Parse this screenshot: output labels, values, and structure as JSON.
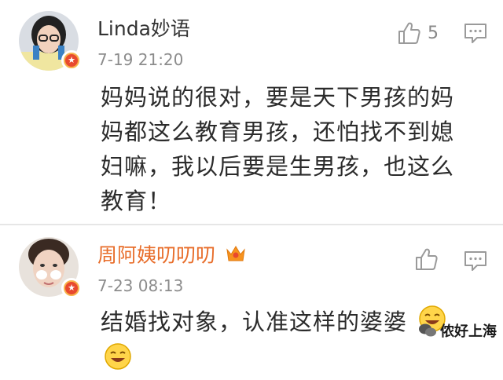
{
  "comments": [
    {
      "username": "Linda妙语",
      "timestamp": "7-19 21:20",
      "like_count": "5",
      "text": "妈妈说的很对，要是天下男孩的妈妈都这么教育男孩，还怕找不到媳妇嘛，我以后要是生男孩，也这么教育！",
      "username_color": "#333333"
    },
    {
      "username": "周阿姨叨叨叨",
      "timestamp": "7-23 08:13",
      "like_count": "",
      "text": "结婚找对象，认准这样的婆婆",
      "username_color": "#e86d2a"
    }
  ],
  "watermark": {
    "text": "侬好上海"
  },
  "colors": {
    "vip_orange": "#f7931e",
    "badge_red": "#e8492e",
    "icon_gray": "#9a9a9a"
  },
  "icons": [
    "thumbs-up-icon",
    "comment-icon",
    "vip-crown-icon",
    "laughing-emoji-icon",
    "wechat-icon"
  ]
}
